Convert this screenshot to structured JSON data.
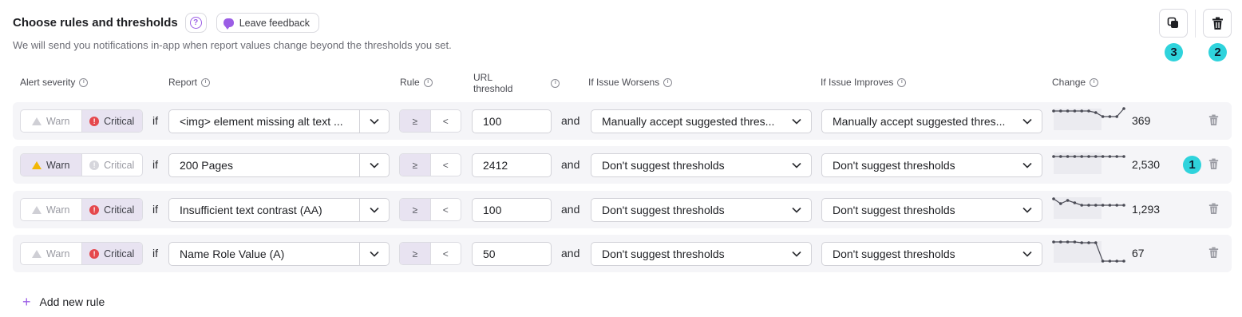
{
  "header": {
    "title": "Choose rules and thresholds",
    "help_icon": "question-icon",
    "feedback_label": "Leave feedback",
    "subtitle": "We will send you notifications in-app when report values change beyond the thresholds you set."
  },
  "toolbar": {
    "copy_icon": "copy-icon",
    "delete_all_icon": "trash-icon"
  },
  "annotations": {
    "copy": "3",
    "delete_all": "2",
    "row_change": "1"
  },
  "columns": {
    "alert_severity": "Alert severity",
    "report": "Report",
    "rule": "Rule",
    "url_threshold_line1": "URL",
    "url_threshold_line2": "threshold",
    "worsens": "If Issue Worsens",
    "improves": "If Issue Improves",
    "change": "Change"
  },
  "labels": {
    "warn": "Warn",
    "critical": "Critical",
    "if": "if",
    "and": "and",
    "gte": "≥",
    "lt": "<"
  },
  "rows": [
    {
      "severity": "Critical",
      "report": "<img> element missing alt text ...",
      "rule": "≥",
      "threshold": "100",
      "worsens": "Manually accept suggested thres...",
      "improves": "Manually accept suggested thres...",
      "change": "369",
      "spark": [
        5,
        5,
        5,
        5,
        5,
        5,
        7,
        12,
        12,
        12,
        2
      ]
    },
    {
      "severity": "Warn",
      "report": "200 Pages",
      "rule": "≥",
      "threshold": "2412",
      "worsens": "Don't suggest thresholds",
      "improves": "Don't suggest thresholds",
      "change": "2,530",
      "spark": [
        7,
        7,
        7,
        7,
        7,
        7,
        7,
        7,
        7,
        7,
        7
      ]
    },
    {
      "severity": "Critical",
      "report": "Insufficient text contrast (AA)",
      "rule": "≥",
      "threshold": "100",
      "worsens": "Don't suggest thresholds",
      "improves": "Don't suggest thresholds",
      "change": "1,293",
      "spark": [
        4,
        10,
        6,
        9,
        12,
        12,
        12,
        12,
        12,
        12,
        12
      ]
    },
    {
      "severity": "Critical",
      "report": "Name Role Value (A)",
      "rule": "≥",
      "threshold": "50",
      "worsens": "Don't suggest thresholds",
      "improves": "Don't suggest thresholds",
      "change": "67",
      "spark": [
        3,
        3,
        3,
        3,
        4,
        4,
        4,
        27,
        27,
        27,
        27
      ]
    }
  ],
  "add_rule_label": "Add new rule"
}
